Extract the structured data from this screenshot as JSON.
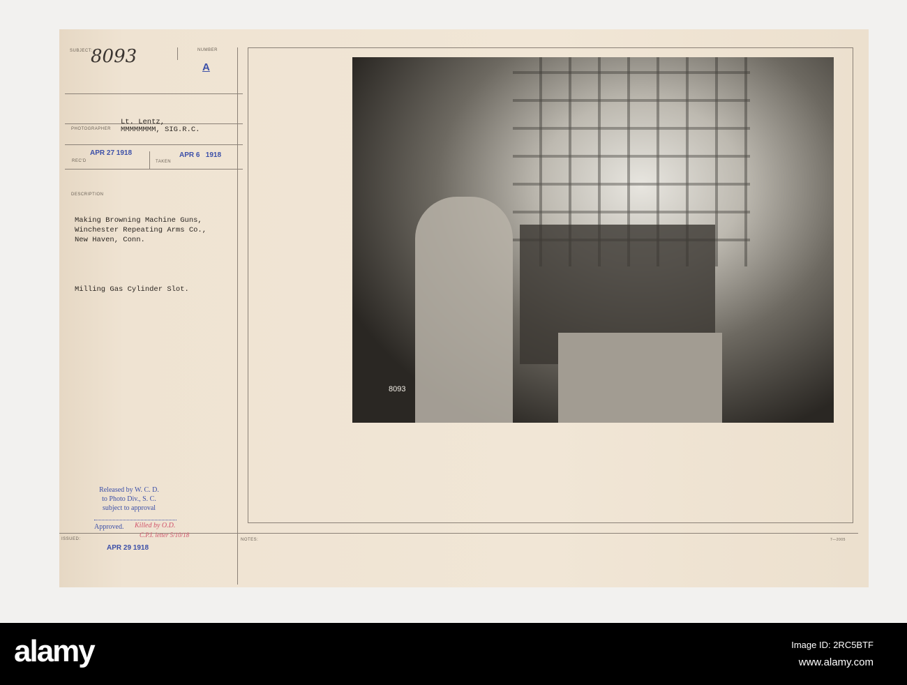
{
  "card": {
    "subject_label": "SUBJECT:",
    "subject_value": "8093",
    "number_label": "NUMBER",
    "number_value": "A",
    "photographer_label": "PHOTOGRAPHER",
    "photographer_line1": "Lt. Lentz,",
    "photographer_line2": "MMMMMMMM, SIG.R.C.",
    "recd_label": "REC'D",
    "recd_date": "APR 27 1918",
    "taken_label": "TAKEN",
    "taken_date": "APR 6   1918",
    "description_label": "DESCRIPTION",
    "description_lines": [
      "Making Browning Machine Guns,",
      "Winchester Repeating Arms Co.,",
      "New Haven, Conn."
    ],
    "caption": "Milling Gas Cylinder Slot.",
    "release_lines": [
      "Released by W. C. D.",
      "to Photo Div., S. C.",
      "subject to approval"
    ],
    "approved_label": "Approved.",
    "approved_sig": "Killed by O.D.",
    "approved_note": "C.P.I. letter 5/10/18",
    "issued_label": "ISSUED:",
    "issued_date": "APR 29 1918",
    "notes_label": "NOTES:",
    "form_number": "7—2005",
    "photo_number": "8093"
  },
  "footer": {
    "logo": "alamy",
    "image_id": "Image ID: 2RC5BTF",
    "site": "www.alamy.com"
  }
}
